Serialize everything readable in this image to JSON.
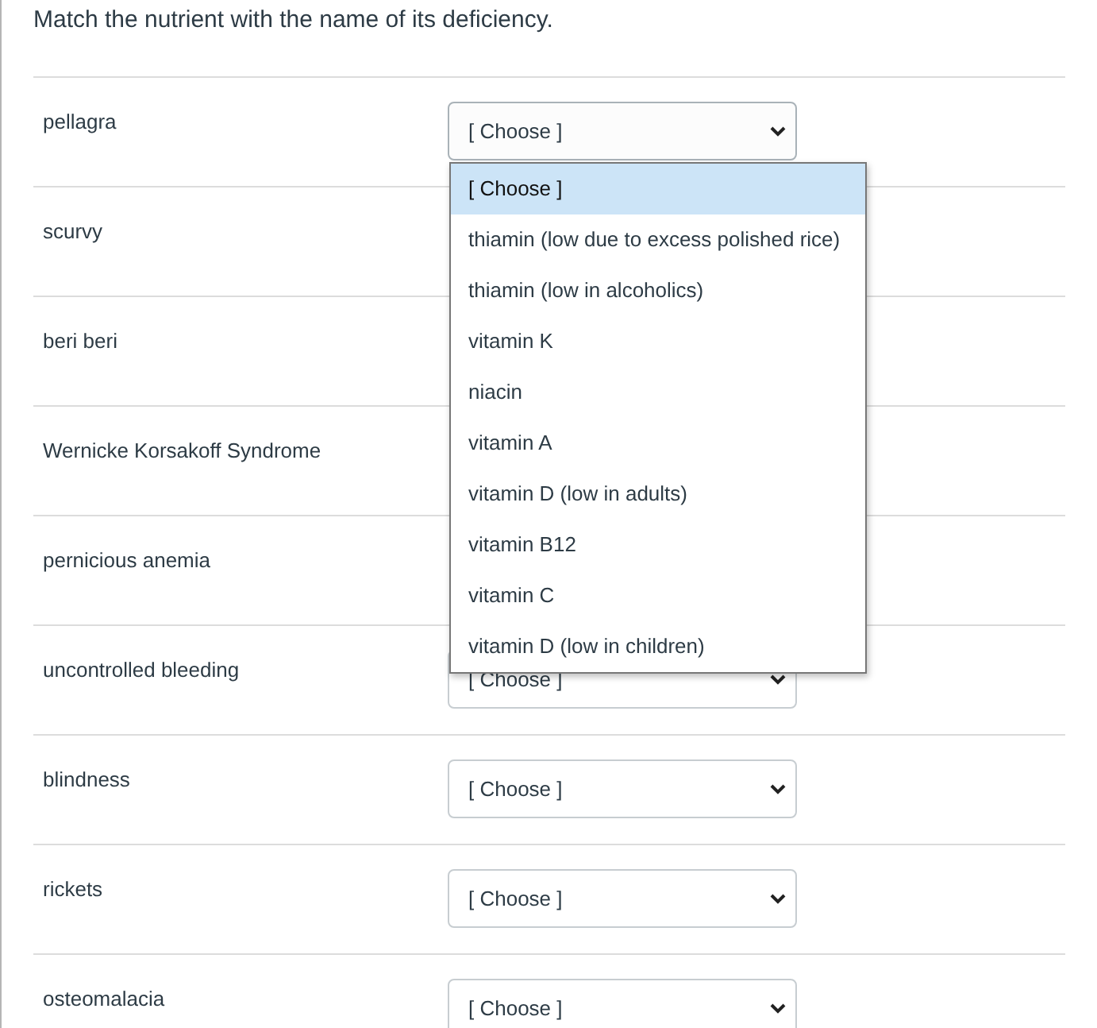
{
  "question": {
    "text": "Match the nutrient with the name of its deficiency."
  },
  "rows": [
    {
      "label": "pellagra",
      "select": {
        "value": "[ Choose ]",
        "expanded": true
      }
    },
    {
      "label": "scurvy"
    },
    {
      "label": "beri beri"
    },
    {
      "label": "Wernicke Korsakoff Syndrome"
    },
    {
      "label": "pernicious anemia"
    },
    {
      "label": "uncontrolled bleeding",
      "select": {
        "value": "[ Choose ]",
        "expanded": false
      }
    },
    {
      "label": "blindness",
      "select": {
        "value": "[ Choose ]",
        "expanded": false
      }
    },
    {
      "label": "rickets",
      "select": {
        "value": "[ Choose ]",
        "expanded": false
      }
    },
    {
      "label": "osteomalacia",
      "select": {
        "value": "[ Choose ]",
        "expanded": false
      }
    }
  ],
  "dropdown": {
    "options": [
      {
        "label": "[ Choose ]",
        "selected": true
      },
      {
        "label": "thiamin (low due to excess polished rice)",
        "selected": false
      },
      {
        "label": "thiamin (low in alcoholics)",
        "selected": false
      },
      {
        "label": "vitamin K",
        "selected": false
      },
      {
        "label": "niacin",
        "selected": false
      },
      {
        "label": "vitamin A",
        "selected": false
      },
      {
        "label": "vitamin D (low in adults)",
        "selected": false
      },
      {
        "label": "vitamin B12",
        "selected": false
      },
      {
        "label": "vitamin C",
        "selected": false
      },
      {
        "label": "vitamin D (low in children)",
        "selected": false
      }
    ]
  }
}
